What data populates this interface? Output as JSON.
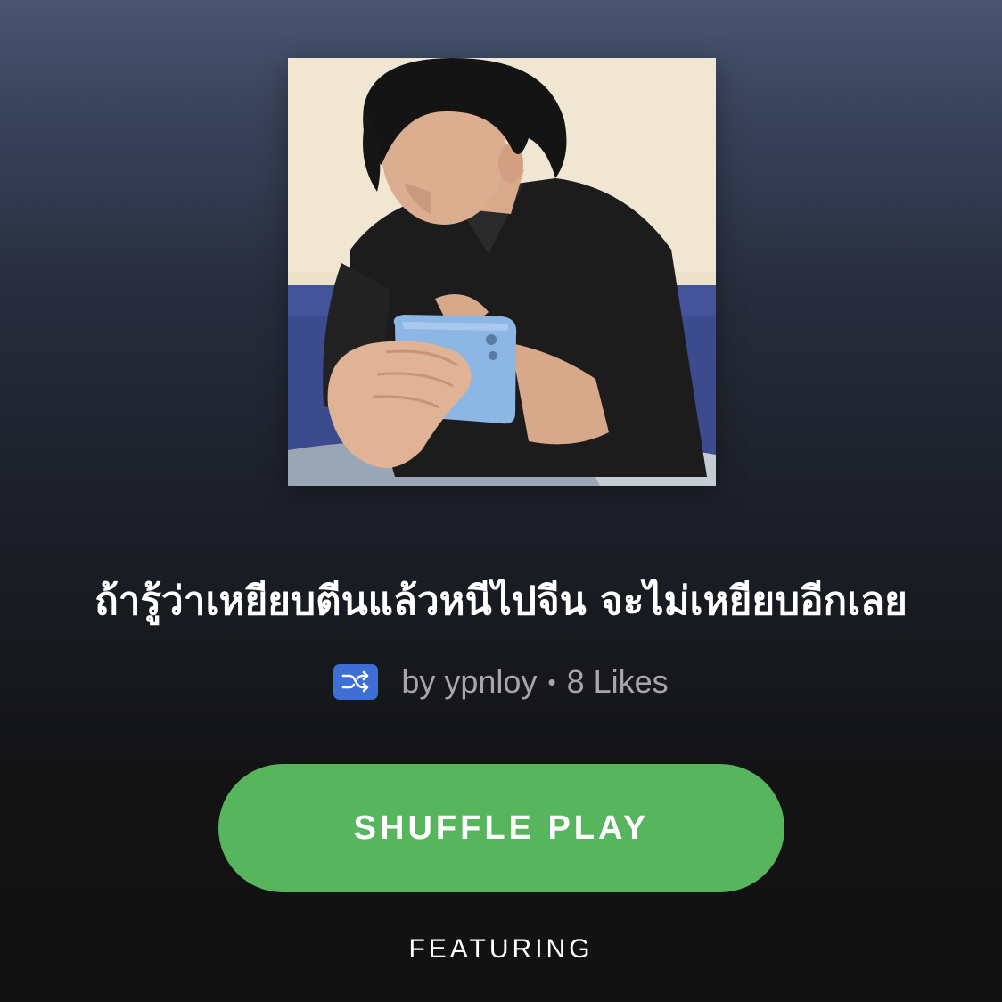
{
  "playlist": {
    "cover": {
      "alt": "young man with dark hair in black polo shirt holding a light-blue phone"
    },
    "title": "ถ้ารู้ว่าเหยียบตีนแล้วหนีไปจีน จะไม่เหยียบอีกเลย",
    "badge_icon": "shuffle-icon",
    "owner_text": "by ypnloy",
    "separator": "•",
    "likes_text": "8 Likes"
  },
  "actions": {
    "shuffle_play_label": "SHUFFLE PLAY"
  },
  "sections": {
    "featuring_label": "FEATURING"
  },
  "colors": {
    "accent_green": "#57b55e",
    "badge_blue": "#3d6fd6",
    "muted_text": "#a7a7a7",
    "background_top": "#4a5573",
    "background_bottom": "#121212"
  }
}
